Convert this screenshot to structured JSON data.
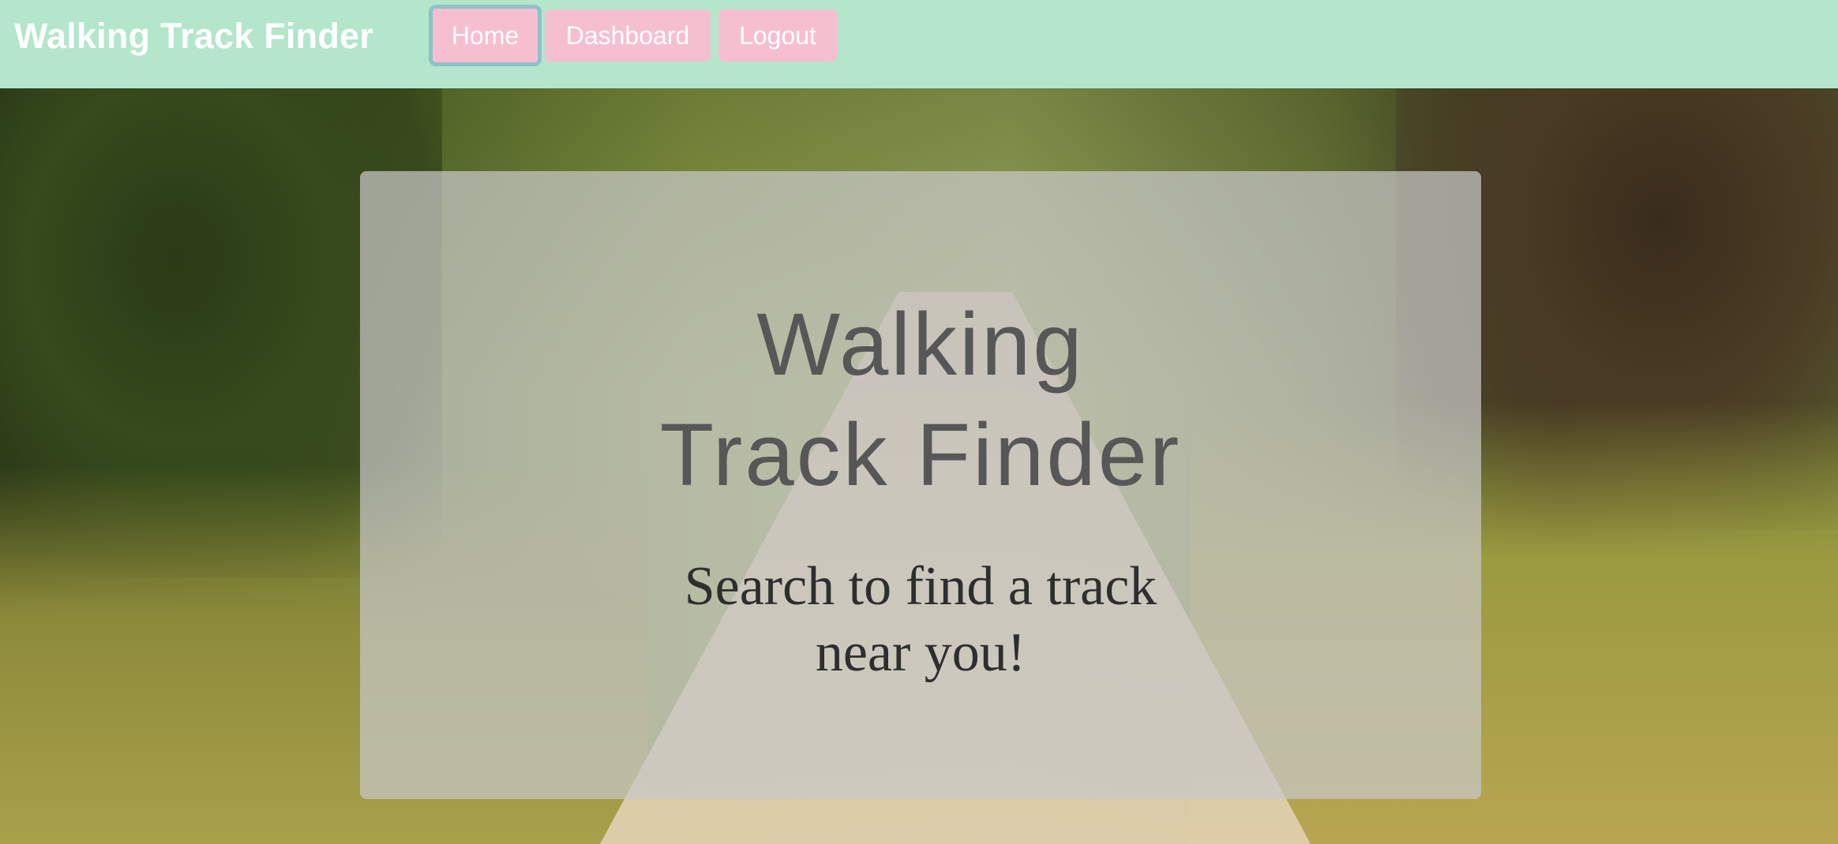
{
  "navbar": {
    "brand": "Walking Track Finder",
    "items": [
      {
        "label": "Home",
        "active": true
      },
      {
        "label": "Dashboard",
        "active": false
      },
      {
        "label": "Logout",
        "active": false
      }
    ],
    "background_color": "#b3e6ca",
    "button_color": "#f6bfd0"
  },
  "hero": {
    "title_line1": "Walking",
    "title_line2": "Track Finder",
    "subtitle_line1": "Search to find a track",
    "subtitle_line2": "near you!"
  }
}
